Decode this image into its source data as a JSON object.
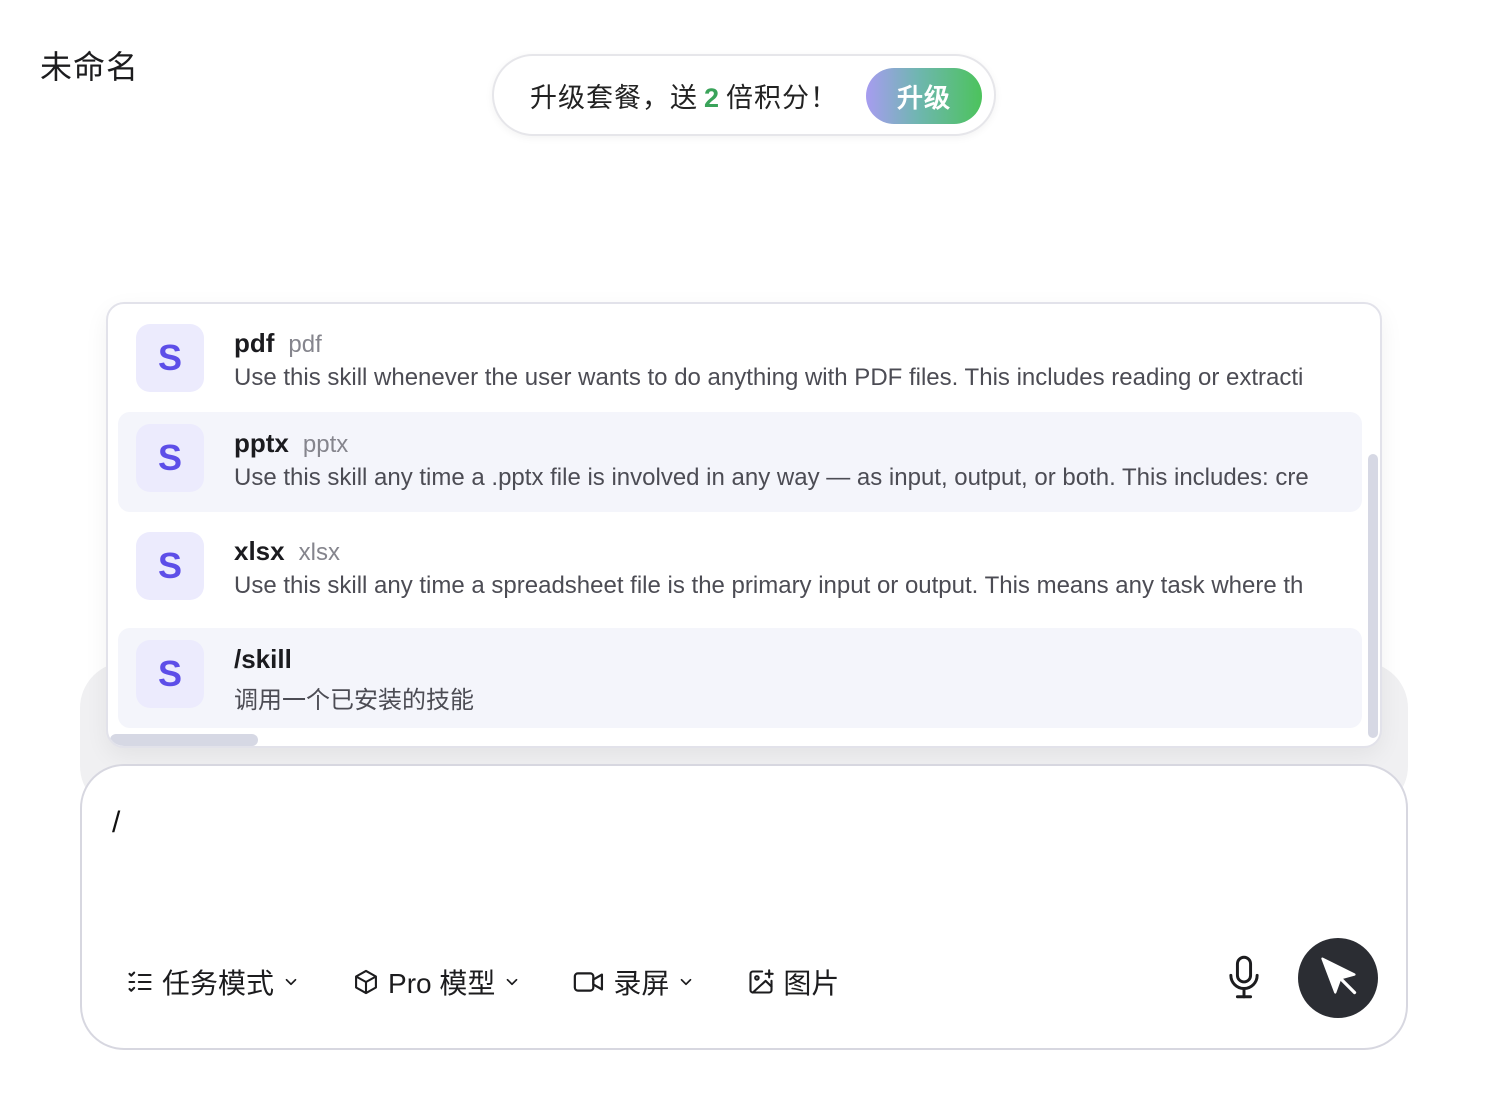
{
  "doc": {
    "title": "未命名"
  },
  "promo": {
    "text_before": "升级套餐，送",
    "multiplier": "2",
    "text_after": "倍积分！",
    "button_label": "升级"
  },
  "skills": [
    {
      "icon_letter": "S",
      "name": "pdf",
      "sub": "pdf",
      "desc": "Use this skill whenever the user wants to do anything with PDF files. This includes reading or extracti"
    },
    {
      "icon_letter": "S",
      "name": "pptx",
      "sub": "pptx",
      "desc": "Use this skill any time a .pptx file is involved in any way — as input, output, or both. This includes: cre"
    },
    {
      "icon_letter": "S",
      "name": "xlsx",
      "sub": "xlsx",
      "desc": "Use this skill any time a spreadsheet file is the primary input or output. This means any task where th"
    },
    {
      "icon_letter": "S",
      "name": "/skill",
      "sub": "",
      "desc": "调用一个已安装的技能"
    }
  ],
  "composer": {
    "input_value": "/",
    "tools": {
      "task_mode": "任务模式",
      "model": "Pro 模型",
      "record": "录屏",
      "image": "图片"
    }
  },
  "colors": {
    "accent_purple": "#5d4ee8",
    "promo_green": "#3aa35a",
    "send_bg": "#2b2d33"
  }
}
